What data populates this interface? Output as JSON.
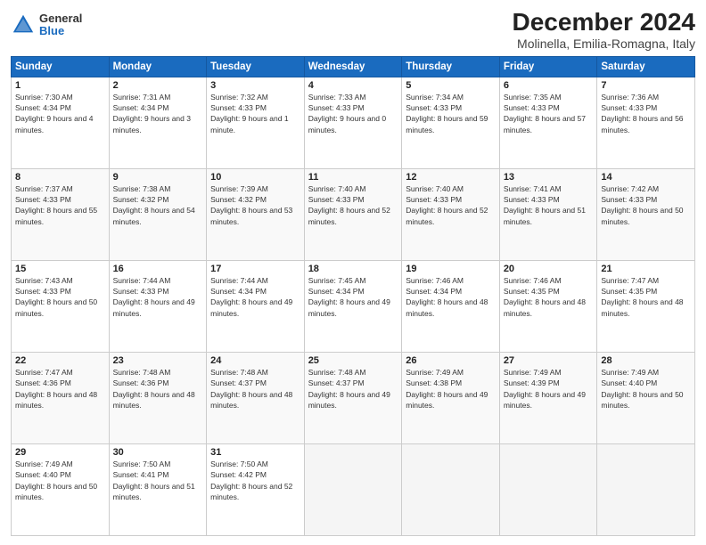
{
  "header": {
    "logo": {
      "general": "General",
      "blue": "Blue"
    },
    "title": "December 2024",
    "subtitle": "Molinella, Emilia-Romagna, Italy"
  },
  "calendar": {
    "days_of_week": [
      "Sunday",
      "Monday",
      "Tuesday",
      "Wednesday",
      "Thursday",
      "Friday",
      "Saturday"
    ],
    "weeks": [
      [
        null,
        {
          "day": 2,
          "sunrise": "7:31 AM",
          "sunset": "4:34 PM",
          "daylight": "9 hours and 3 minutes."
        },
        {
          "day": 3,
          "sunrise": "7:32 AM",
          "sunset": "4:33 PM",
          "daylight": "9 hours and 1 minute."
        },
        {
          "day": 4,
          "sunrise": "7:33 AM",
          "sunset": "4:33 PM",
          "daylight": "9 hours and 0 minutes."
        },
        {
          "day": 5,
          "sunrise": "7:34 AM",
          "sunset": "4:33 PM",
          "daylight": "8 hours and 59 minutes."
        },
        {
          "day": 6,
          "sunrise": "7:35 AM",
          "sunset": "4:33 PM",
          "daylight": "8 hours and 57 minutes."
        },
        {
          "day": 7,
          "sunrise": "7:36 AM",
          "sunset": "4:33 PM",
          "daylight": "8 hours and 56 minutes."
        }
      ],
      [
        {
          "day": 1,
          "sunrise": "7:30 AM",
          "sunset": "4:34 PM",
          "daylight": "9 hours and 4 minutes."
        },
        {
          "day": 8,
          "sunrise": "7:37 AM",
          "sunset": "4:33 PM",
          "daylight": "8 hours and 55 minutes."
        },
        {
          "day": 9,
          "sunrise": "7:38 AM",
          "sunset": "4:32 PM",
          "daylight": "8 hours and 54 minutes."
        },
        {
          "day": 10,
          "sunrise": "7:39 AM",
          "sunset": "4:32 PM",
          "daylight": "8 hours and 53 minutes."
        },
        {
          "day": 11,
          "sunrise": "7:40 AM",
          "sunset": "4:33 PM",
          "daylight": "8 hours and 52 minutes."
        },
        {
          "day": 12,
          "sunrise": "7:40 AM",
          "sunset": "4:33 PM",
          "daylight": "8 hours and 52 minutes."
        },
        {
          "day": 13,
          "sunrise": "7:41 AM",
          "sunset": "4:33 PM",
          "daylight": "8 hours and 51 minutes."
        },
        {
          "day": 14,
          "sunrise": "7:42 AM",
          "sunset": "4:33 PM",
          "daylight": "8 hours and 50 minutes."
        }
      ],
      [
        {
          "day": 15,
          "sunrise": "7:43 AM",
          "sunset": "4:33 PM",
          "daylight": "8 hours and 50 minutes."
        },
        {
          "day": 16,
          "sunrise": "7:44 AM",
          "sunset": "4:33 PM",
          "daylight": "8 hours and 49 minutes."
        },
        {
          "day": 17,
          "sunrise": "7:44 AM",
          "sunset": "4:34 PM",
          "daylight": "8 hours and 49 minutes."
        },
        {
          "day": 18,
          "sunrise": "7:45 AM",
          "sunset": "4:34 PM",
          "daylight": "8 hours and 49 minutes."
        },
        {
          "day": 19,
          "sunrise": "7:46 AM",
          "sunset": "4:34 PM",
          "daylight": "8 hours and 48 minutes."
        },
        {
          "day": 20,
          "sunrise": "7:46 AM",
          "sunset": "4:35 PM",
          "daylight": "8 hours and 48 minutes."
        },
        {
          "day": 21,
          "sunrise": "7:47 AM",
          "sunset": "4:35 PM",
          "daylight": "8 hours and 48 minutes."
        }
      ],
      [
        {
          "day": 22,
          "sunrise": "7:47 AM",
          "sunset": "4:36 PM",
          "daylight": "8 hours and 48 minutes."
        },
        {
          "day": 23,
          "sunrise": "7:48 AM",
          "sunset": "4:36 PM",
          "daylight": "8 hours and 48 minutes."
        },
        {
          "day": 24,
          "sunrise": "7:48 AM",
          "sunset": "4:37 PM",
          "daylight": "8 hours and 48 minutes."
        },
        {
          "day": 25,
          "sunrise": "7:48 AM",
          "sunset": "4:37 PM",
          "daylight": "8 hours and 49 minutes."
        },
        {
          "day": 26,
          "sunrise": "7:49 AM",
          "sunset": "4:38 PM",
          "daylight": "8 hours and 49 minutes."
        },
        {
          "day": 27,
          "sunrise": "7:49 AM",
          "sunset": "4:39 PM",
          "daylight": "8 hours and 49 minutes."
        },
        {
          "day": 28,
          "sunrise": "7:49 AM",
          "sunset": "4:40 PM",
          "daylight": "8 hours and 50 minutes."
        }
      ],
      [
        {
          "day": 29,
          "sunrise": "7:49 AM",
          "sunset": "4:40 PM",
          "daylight": "8 hours and 50 minutes."
        },
        {
          "day": 30,
          "sunrise": "7:50 AM",
          "sunset": "4:41 PM",
          "daylight": "8 hours and 51 minutes."
        },
        {
          "day": 31,
          "sunrise": "7:50 AM",
          "sunset": "4:42 PM",
          "daylight": "8 hours and 52 minutes."
        },
        null,
        null,
        null,
        null
      ]
    ]
  }
}
